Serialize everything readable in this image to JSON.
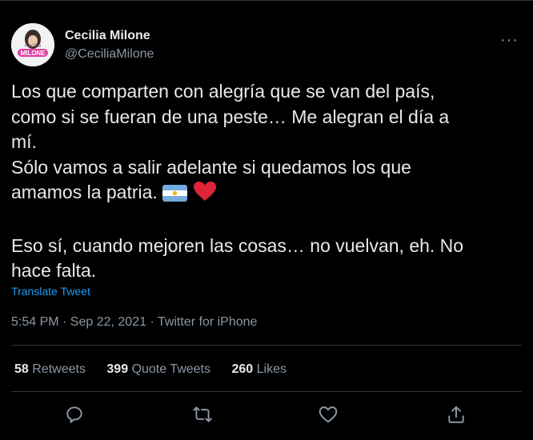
{
  "author": {
    "name": "Cecilia Milone",
    "handle": "@CeciliaMilone",
    "avatar_text": "Cecilia MILONE"
  },
  "menu_icon": "more-icon",
  "tweet": {
    "line1": "Los que comparten con alegría que se van del país,",
    "line2": "como si se fueran de una peste… Me alegran el día a",
    "line3": "mí.",
    "line4": "Sólo vamos a salir adelante si quedamos los que",
    "line5": "amamos la patria.",
    "line6": "Eso sí, cuando mejoren las cosas… no vuelvan, eh. No",
    "line7": "hace falta."
  },
  "translate_label": "Translate Tweet",
  "meta": "5:54 PM · Sep 22, 2021 · Twitter for iPhone",
  "stats": {
    "retweets_count": "58",
    "retweets_label": "Retweets",
    "quote_count": "399",
    "quote_label": "Quote Tweets",
    "likes_count": "260",
    "likes_label": "Likes"
  },
  "actions": [
    "reply-icon",
    "retweet-icon",
    "like-icon",
    "share-icon"
  ],
  "colors": {
    "background": "#000000",
    "link": "#1d9bf0",
    "muted": "#8b98a5",
    "text": "#e7e9ea"
  }
}
